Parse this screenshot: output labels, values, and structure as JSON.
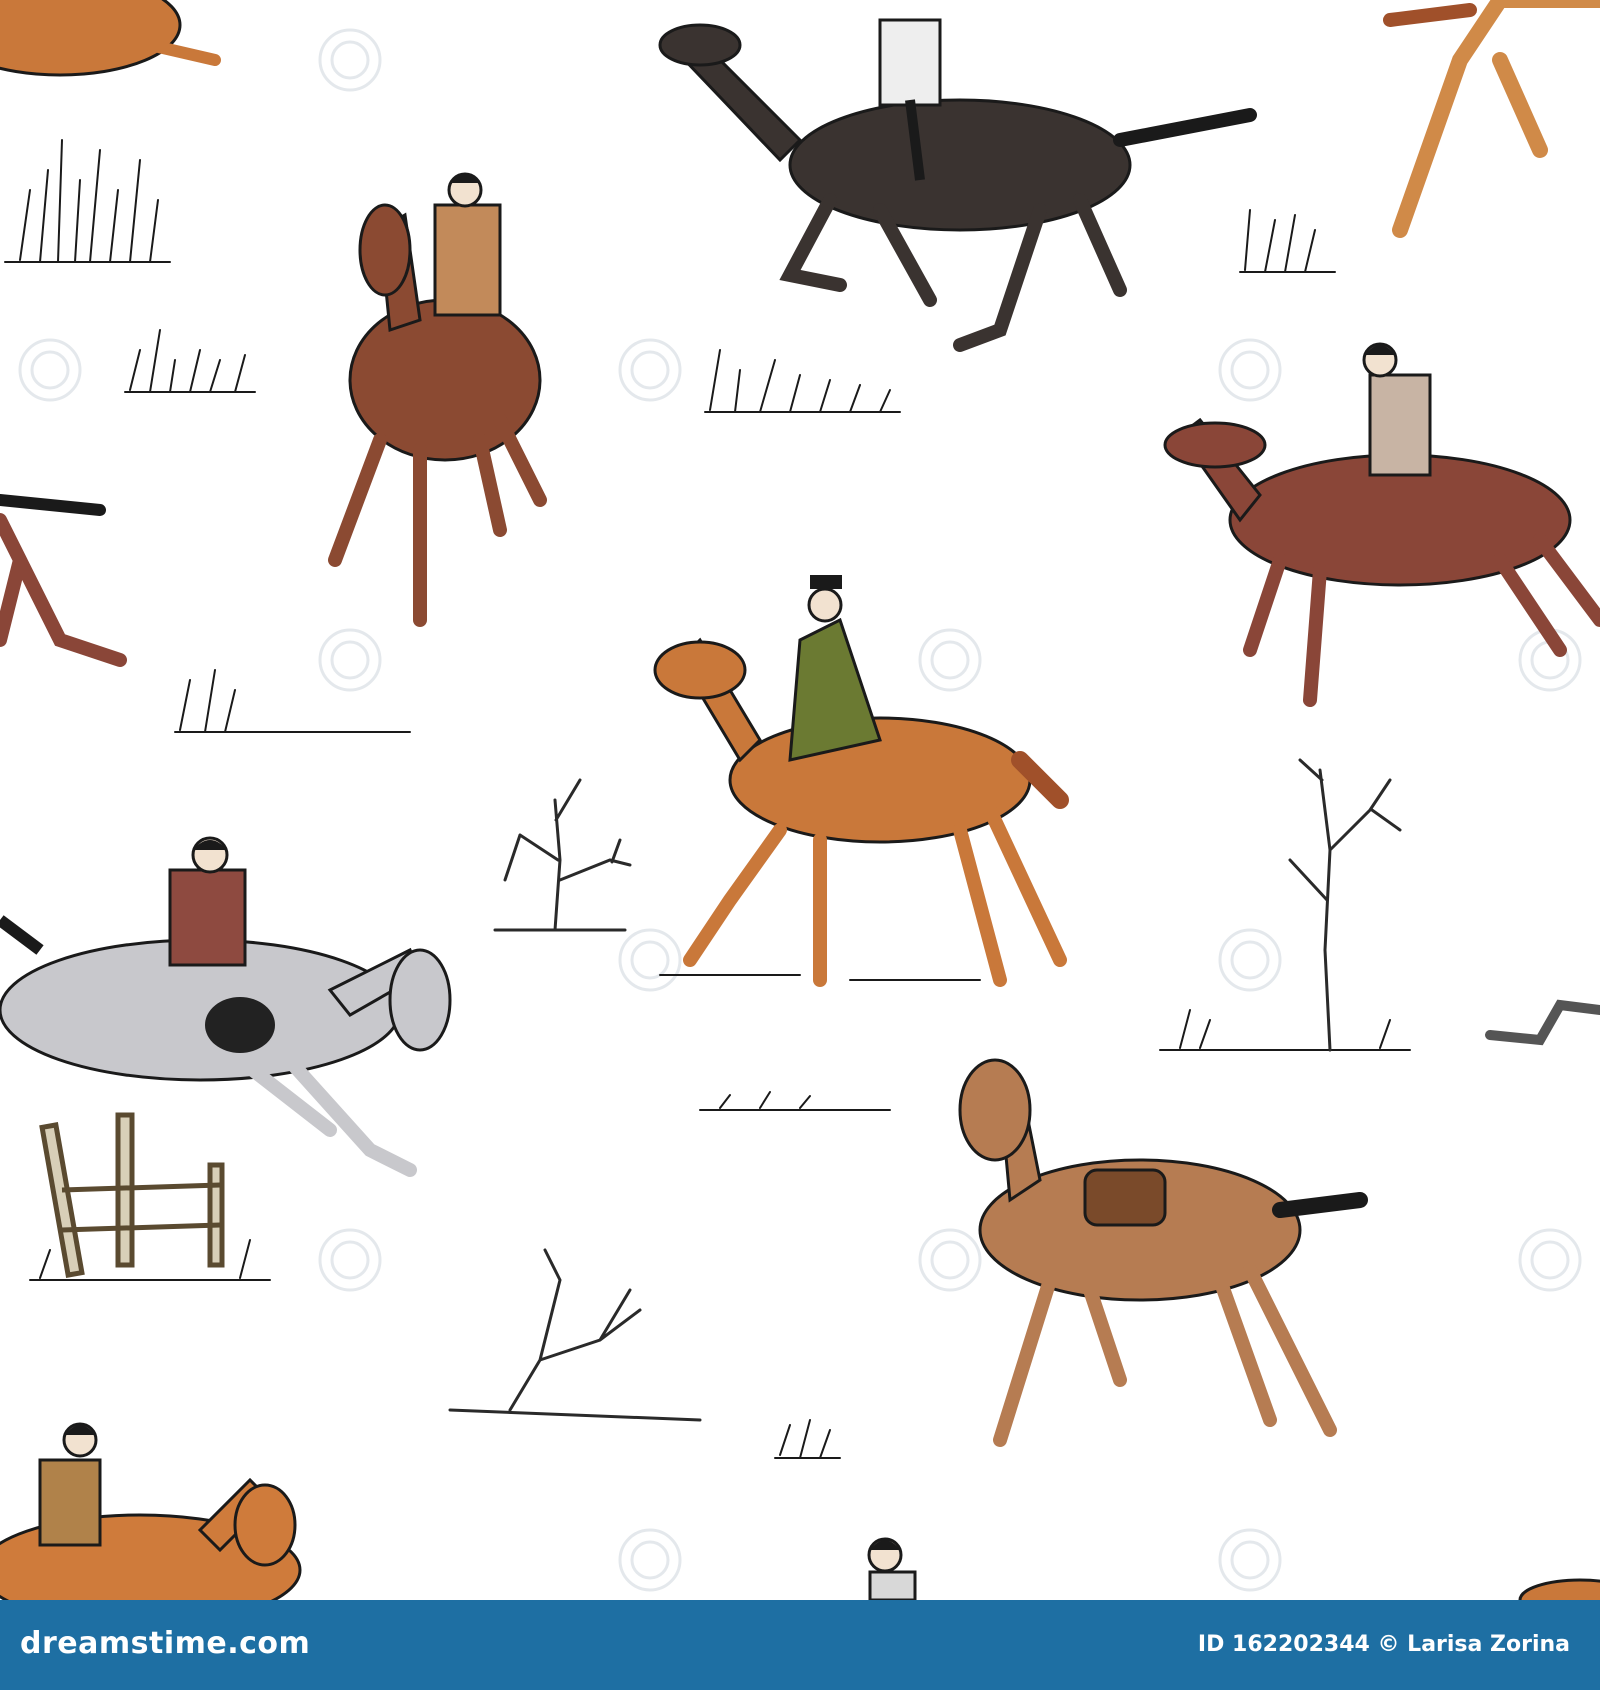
{
  "footer": {
    "brand": "dreamstime.com",
    "image_id_label": "ID",
    "image_id": "162202344",
    "copyright": "©",
    "author": "Larisa Zorina"
  },
  "colors": {
    "background": "#ffffff",
    "footer_bar": "#1e6fa3",
    "footer_text": "#ffffff",
    "ink": "#1a1a1a",
    "watermark": "#e4e8ec"
  },
  "horses": [
    {
      "name": "dark-bay-galloping",
      "coat": "#3a3330"
    },
    {
      "name": "chestnut-cantering-front",
      "coat": "#8b4a32"
    },
    {
      "name": "bay-galloping-right",
      "coat": "#8a4638"
    },
    {
      "name": "sorrel-sidesaddle",
      "coat": "#c9783a"
    },
    {
      "name": "grey-dappled-jumping",
      "coat": "#c8c8cc"
    },
    {
      "name": "tan-saddled-riderless",
      "coat": "#b67c52"
    },
    {
      "name": "chestnut-bottom-left",
      "coat": "#cf7b3b"
    },
    {
      "name": "orange-top-left-partial",
      "coat": "#c9783a"
    },
    {
      "name": "orange-top-right-partial",
      "coat": "#d08a48"
    }
  ]
}
